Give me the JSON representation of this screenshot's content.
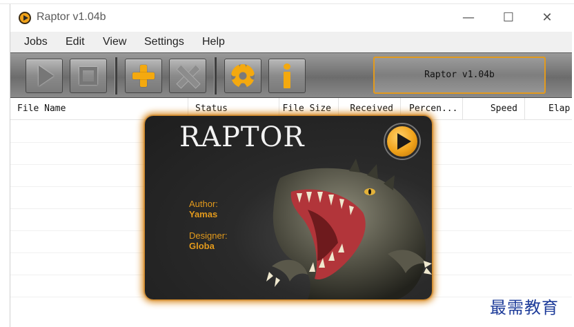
{
  "window": {
    "title": "Raptor v1.04b",
    "min_glyph": "—",
    "max_glyph": "☐",
    "close_glyph": "✕"
  },
  "menu": [
    {
      "label": "Jobs"
    },
    {
      "label": "Edit"
    },
    {
      "label": "View"
    },
    {
      "label": "Settings"
    },
    {
      "label": "Help"
    }
  ],
  "toolbar": {
    "buttons": [
      {
        "icon": "play-icon"
      },
      {
        "icon": "stop-icon"
      },
      {
        "icon": "plus-icon"
      },
      {
        "icon": "delete-x-icon"
      },
      {
        "icon": "gear-icon"
      },
      {
        "icon": "info-icon"
      }
    ],
    "version_label": "Raptor v1.04b"
  },
  "table": {
    "columns": [
      "File Name",
      "Status",
      "File Size",
      "Received",
      "Percen...",
      "Speed",
      "Elap"
    ]
  },
  "about": {
    "title": "RAPTOR",
    "author_label": "Author:",
    "author": "Yamas",
    "designer_label": "Designer:",
    "designer": "Globa"
  },
  "watermark": "最需教育",
  "colors": {
    "accent": "#e39a1c",
    "icon_orange": "#f4a90f",
    "toolbar_gray": "#7e7e7e",
    "watermark_blue": "#1e3c9a"
  }
}
